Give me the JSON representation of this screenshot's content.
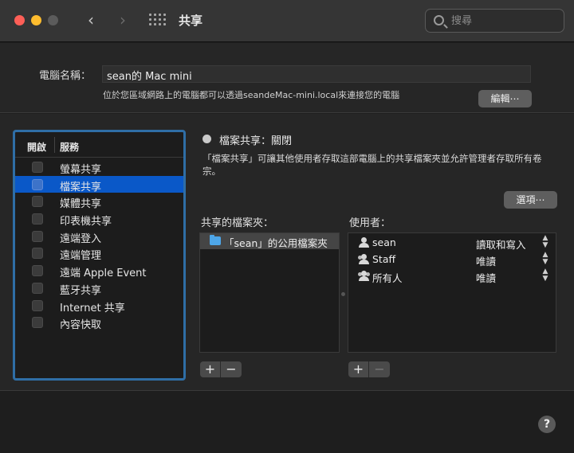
{
  "toolbar": {
    "title": "共享",
    "back_glyph": "‹",
    "forward_glyph": "›",
    "search_placeholder": "搜尋"
  },
  "computer_name": {
    "label": "電腦名稱：",
    "value": "sean的 Mac mini",
    "subtitle": "位於您區域網路上的電腦都可以透過seandeMac-mini.local來連接您的電腦",
    "edit_label": "編輯⋯"
  },
  "services": {
    "header_on": "開啟",
    "header_service": "服務",
    "items": [
      {
        "label": "螢幕共享",
        "selected": false
      },
      {
        "label": "檔案共享",
        "selected": true
      },
      {
        "label": "媒體共享",
        "selected": false
      },
      {
        "label": "印表機共享",
        "selected": false
      },
      {
        "label": "遠端登入",
        "selected": false
      },
      {
        "label": "遠端管理",
        "selected": false
      },
      {
        "label": "遠端 Apple Event",
        "selected": false
      },
      {
        "label": "藍牙共享",
        "selected": false
      },
      {
        "label": "Internet 共享",
        "selected": false
      },
      {
        "label": "內容快取",
        "selected": false
      }
    ]
  },
  "detail": {
    "status": "檔案共享：關閉",
    "description": "「檔案共享」可讓其他使用者存取這部電腦上的共享檔案夾並允許管理者存取所有卷宗。",
    "options_label": "選項⋯",
    "folders_label": "共享的檔案夾：",
    "users_label": "使用者：",
    "folders": [
      "「sean」的公用檔案夾"
    ],
    "users": [
      {
        "name": "sean",
        "permission": "讀取和寫入",
        "icon": "single-user-icon"
      },
      {
        "name": "Staff",
        "permission": "唯讀",
        "icon": "group-icon"
      },
      {
        "name": "所有人",
        "permission": "唯讀",
        "icon": "everyone-icon"
      }
    ],
    "plus": "+",
    "minus": "−"
  },
  "help_label": "?",
  "colors": {
    "selection": "#0a58c8",
    "panel_border": "#2f6ea6",
    "folder": "#4ea6e8"
  }
}
